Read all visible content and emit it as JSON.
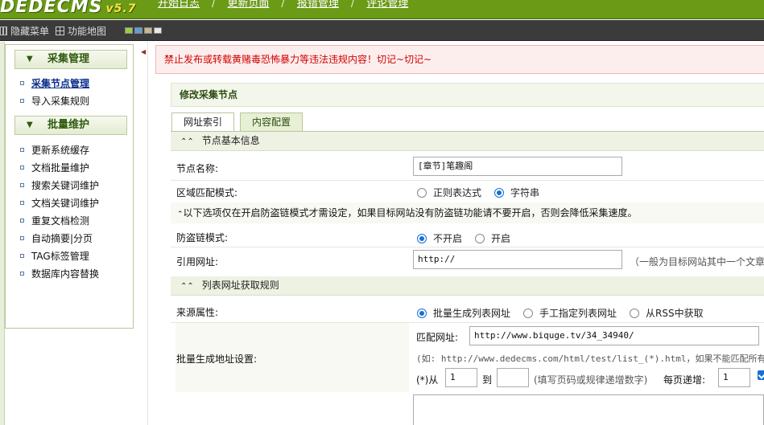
{
  "header": {
    "logo_text": "DEDECMS",
    "version": "v5.7",
    "nav": [
      {
        "label": "开始日志"
      },
      {
        "label": "更新页面"
      },
      {
        "label": "报错管理"
      },
      {
        "label": "评论管理"
      }
    ]
  },
  "toolbar": {
    "hide_menu": "隐藏菜单",
    "function_map": "功能地图",
    "swatch_colors": [
      "#9ccc4a",
      "#5aa0d8",
      "#c8b88a",
      "#e8e8e8"
    ]
  },
  "sidebar": {
    "groups": [
      {
        "title": "采集管理",
        "items": [
          {
            "label": "采集节点管理",
            "active": true
          },
          {
            "label": "导入采集规则"
          }
        ]
      },
      {
        "title": "批量维护",
        "items": [
          {
            "label": "更新系统缓存"
          },
          {
            "label": "文档批量维护"
          },
          {
            "label": "搜索关键词维护"
          },
          {
            "label": "文档关键词维护"
          },
          {
            "label": "重复文档检测"
          },
          {
            "label": "自动摘要|分页"
          },
          {
            "label": "TAG标签管理"
          },
          {
            "label": "数据库内容替换"
          }
        ]
      }
    ]
  },
  "warning": "禁止发布或转载黄赌毒恐怖暴力等违法违规内容！切记~切记~",
  "main": {
    "title": "修改采集节点",
    "tabs": [
      {
        "label": "网址索引",
        "active": false
      },
      {
        "label": "内容配置",
        "active": true
      }
    ],
    "section_basic": "节点基本信息",
    "node_name_label": "节点名称:",
    "node_name_value": "[章节]笔趣阁",
    "match_mode_label": "区域匹配模式:",
    "match_mode_options": [
      "正则表达式",
      "字符串"
    ],
    "match_mode_selected": 1,
    "hotlink_hint": "以下选项仅在开启防盗链模式才需设定，如果目标网站没有防盗链功能请不要开启，否则会降低采集速度。",
    "hotlink_mode_label": "防盗链模式:",
    "hotlink_options": [
      "不开启",
      "开启"
    ],
    "hotlink_selected": 0,
    "referer_label": "引用网址:",
    "referer_value": "http://",
    "referer_note": "（一般为目标网站其中一个文章页网址）",
    "section_list": "列表网址获取规则",
    "source_label": "来源属性:",
    "source_options": [
      "批量生成列表网址",
      "手工指定列表网址",
      "从RSS中获取"
    ],
    "source_selected": 0,
    "batch_label": "批量生成地址设置:",
    "match_url_label": "匹配网址:",
    "match_url_value": "http://www.biquge.tv/34_34940/",
    "example_text": "(如: http://www.dedecms.com/html/test/list_(*).html，如果不能匹配所有网址，可以在手工指定网址的地方输入要追加的网址)",
    "from_label": "(*)从",
    "from_value": "1",
    "to_label": "到",
    "to_value": "",
    "range_note": "(填写页码或规律递增数字)",
    "step_label": "每页递增:",
    "step_value": "1",
    "step_checked": true
  }
}
